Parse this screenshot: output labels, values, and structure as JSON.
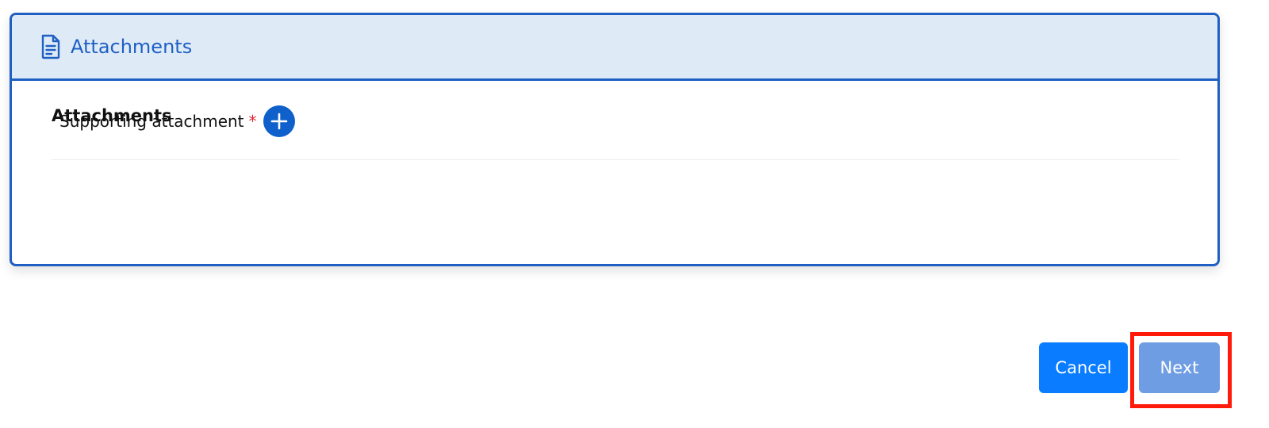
{
  "card": {
    "header_title": "Attachments",
    "header_icon": "document-icon",
    "section_title": "Attachments",
    "field": {
      "label": "Supporting attachment",
      "required_mark": "*",
      "add_icon": "plus-icon"
    }
  },
  "footer": {
    "cancel_label": "Cancel",
    "next_label": "Next"
  },
  "colors": {
    "accent": "#1f5fc3",
    "header_bg": "#deebf7",
    "cancel_bg": "#0a7cff",
    "next_bg": "#6f9de3",
    "required": "#e0272f",
    "highlight": "#ff1a0a"
  }
}
